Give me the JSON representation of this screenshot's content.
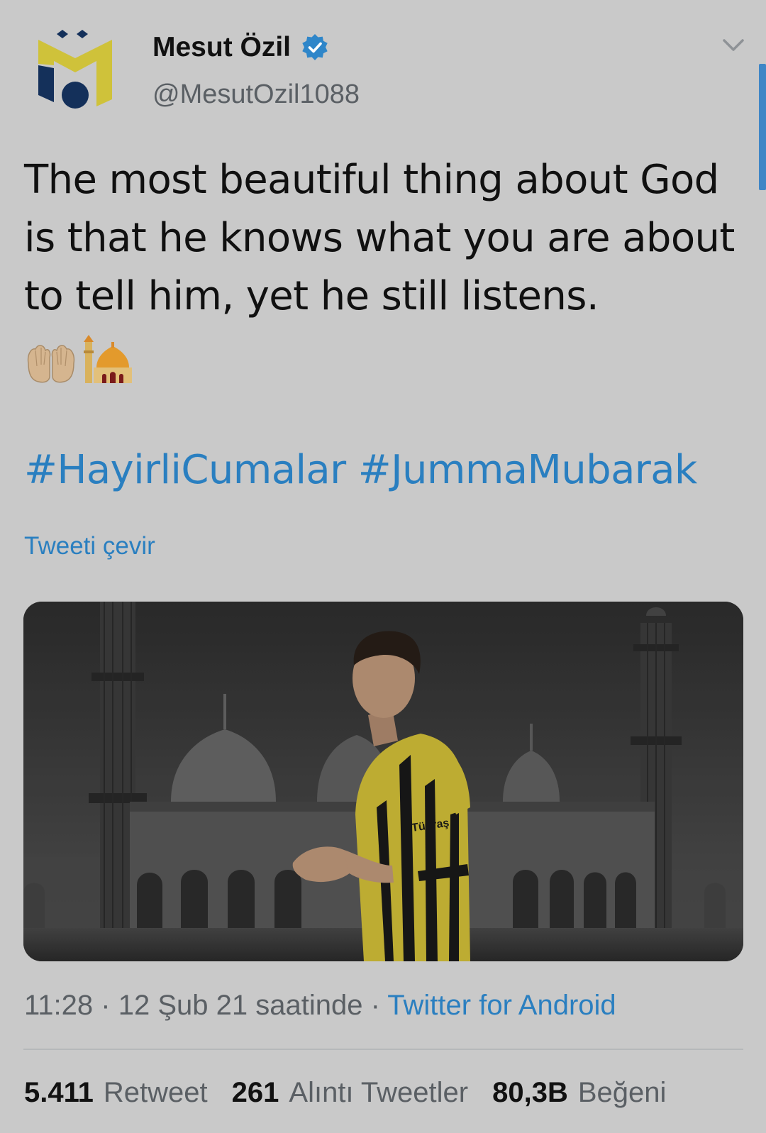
{
  "user": {
    "display_name": "Mesut Özil",
    "handle": "@MesutOzil1088",
    "verified": true
  },
  "tweet": {
    "text": "The most beautiful thing about God is that he knows what you are about to tell him, yet he still listens.",
    "emojis": [
      "palms-up-together-emoji",
      "mosque-emoji"
    ],
    "hashtags": [
      "#HayirliCumalar",
      "#JummaMubarak"
    ],
    "translate_label": "Tweeti çevir",
    "image_text": "Tüpraş",
    "time": "11:28",
    "date": "12 Şub 21 saatinde",
    "separator": "·",
    "source": "Twitter for Android"
  },
  "stats": [
    {
      "value": "5.411",
      "label": "Retweet"
    },
    {
      "value": "261",
      "label": "Alıntı Tweetler"
    },
    {
      "value": "80,3B",
      "label": "Beğeni"
    }
  ],
  "colors": {
    "background": "#c9c9c9",
    "link": "#2a7fc0",
    "verified": "#2f86c9",
    "avatar_yellow": "#cfc23a",
    "avatar_navy": "#14305a"
  }
}
